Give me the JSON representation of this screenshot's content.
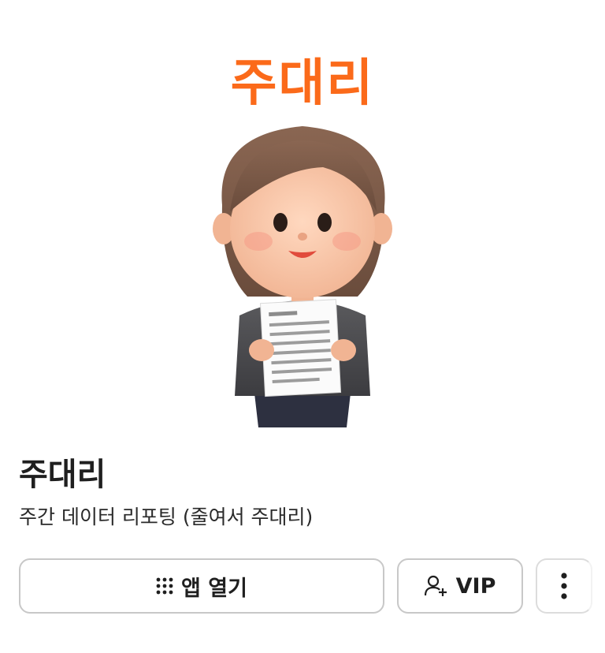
{
  "brand": {
    "logo_text": "주대리",
    "accent_color": "#fb6a1a"
  },
  "app": {
    "title": "주대리",
    "subtitle": "주간 데이터 리포팅 (줄여서 주대리)"
  },
  "actions": {
    "open_label": "앱 열기",
    "open_icon": "grid-dots-icon",
    "vip_label": "VIP",
    "vip_icon": "add-user-icon",
    "more_icon": "more-vertical-icon"
  }
}
